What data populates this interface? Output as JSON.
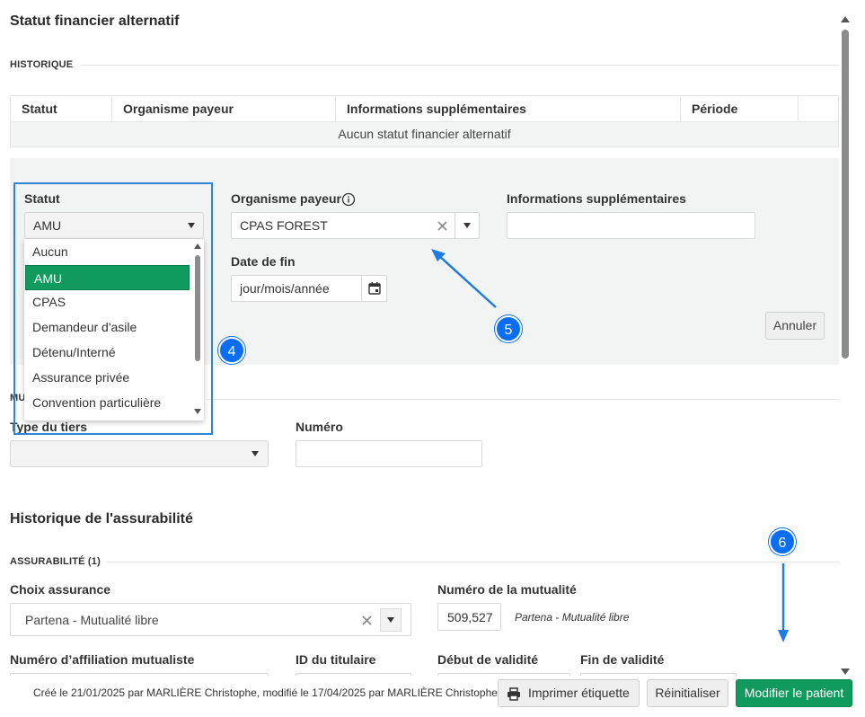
{
  "page": {
    "title": "Statut financier alternatif"
  },
  "historique": {
    "label": "HISTORIQUE",
    "columns": [
      "Statut",
      "Organisme payeur",
      "Informations supplémentaires",
      "Période",
      ""
    ],
    "empty_text": "Aucun statut financier alternatif"
  },
  "form": {
    "statut_label": "Statut",
    "statut_value": "AMU",
    "organisme_label": "Organisme payeur",
    "organisme_value": "CPAS FOREST",
    "infos_label": "Informations supplémentaires",
    "infos_value": "",
    "date_fin_label": "Date de fin",
    "date_fin_placeholder": "jour/mois/année",
    "annuler_label": "Annuler",
    "statut_options": [
      "Aucun",
      "AMU",
      "CPAS",
      "Demandeur d'asile",
      "Détenu/Interné",
      "Assurance privée",
      "Convention particulière"
    ],
    "selected_index": 1
  },
  "tiers": {
    "section_partial": "MU",
    "type_label": "Type du tiers",
    "type_value": "",
    "numero_label": "Numéro",
    "numero_value": ""
  },
  "assurabilite": {
    "title": "Historique de l'assurabilité",
    "section_label": "ASSURABILITÉ (1)",
    "choix_label": "Choix assurance",
    "choix_value": "Partena - Mutualité libre",
    "num_mutualite_label": "Numéro de la mutualité",
    "num_mutualite_value": "509,527",
    "num_mutualite_name": "Partena - Mutualité libre",
    "affiliation_label": "Numéro d’affiliation mutualiste",
    "titulaire_label": "ID du titulaire",
    "debut_label": "Début de validité",
    "fin_label": "Fin de validité"
  },
  "badges": {
    "b4": "4",
    "b5": "5",
    "b6": "6"
  },
  "footer": {
    "meta": "Créé le 21/01/2025 par MARLIÈRE Christophe, modifié le 17/04/2025 par MARLIÈRE Christophe",
    "print_label": "Imprimer étiquette",
    "reset_label": "Réinitialiser",
    "submit_label": "Modifier le patient"
  },
  "colors": {
    "primary_green": "#109a5d",
    "badge_blue": "#0a6ef5",
    "highlight_blue": "#2b86d8"
  }
}
